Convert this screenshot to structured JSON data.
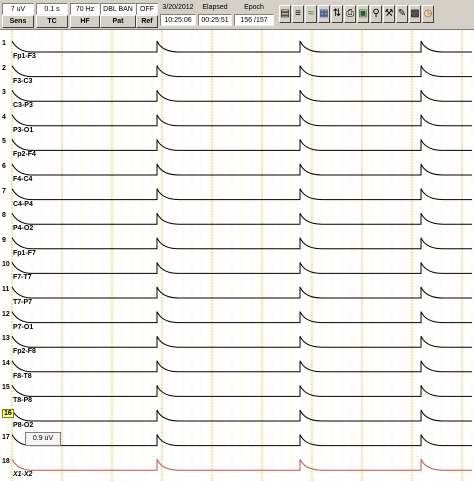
{
  "toolbar": {
    "sensitivity": "7 uV",
    "sens_label": "Sens",
    "timeconst": "0.1 s",
    "tc_label": "TC",
    "highfreq": "70 Hz",
    "hf_label": "HF",
    "montage": "DBL BAN",
    "pat_label": "Pat",
    "ref_value": "OFF",
    "ref_label": "Ref",
    "date": "3/20/2012",
    "time": "10:25:06",
    "elapsed_label": "Elapsed",
    "elapsed": "00:25:51",
    "epoch_label": "Epoch",
    "epoch": "156 /157",
    "icons": [
      "save-icon",
      "montage-icon",
      "filter-icon",
      "layout-icon",
      "timebase-icon",
      "print-icon",
      "zoom-icon",
      "search-icon",
      "tools-icon",
      "notes-icon",
      "grid-icon",
      "clock-icon"
    ]
  },
  "channels": [
    {
      "num": "1",
      "label": "Fp1-F3"
    },
    {
      "num": "2",
      "label": "F3-C3"
    },
    {
      "num": "3",
      "label": "C3-P3"
    },
    {
      "num": "4",
      "label": "P3-O1"
    },
    {
      "num": "5",
      "label": "Fp2-F4"
    },
    {
      "num": "6",
      "label": "F4-C4"
    },
    {
      "num": "7",
      "label": "C4-P4"
    },
    {
      "num": "8",
      "label": "P4-O2"
    },
    {
      "num": "9",
      "label": "Fp1-F7"
    },
    {
      "num": "10",
      "label": "F7-T7"
    },
    {
      "num": "11",
      "label": "T7-P7"
    },
    {
      "num": "12",
      "label": "P7-O1"
    },
    {
      "num": "13",
      "label": "Fp2-F8"
    },
    {
      "num": "14",
      "label": "F8-T8"
    },
    {
      "num": "15",
      "label": "T8-P8"
    },
    {
      "num": "16",
      "label": "P8-O2"
    },
    {
      "num": "17",
      "label": ""
    },
    {
      "num": "18",
      "label": "X1-X2"
    }
  ],
  "selected_channel": "16",
  "popup_value": "0.9 uV",
  "colors": {
    "trace": "#000000",
    "last_trace": "#c05050",
    "grid_major": "#d8c800",
    "grid_minor": "#f0e890",
    "toolbar": "#d4d0c8"
  }
}
